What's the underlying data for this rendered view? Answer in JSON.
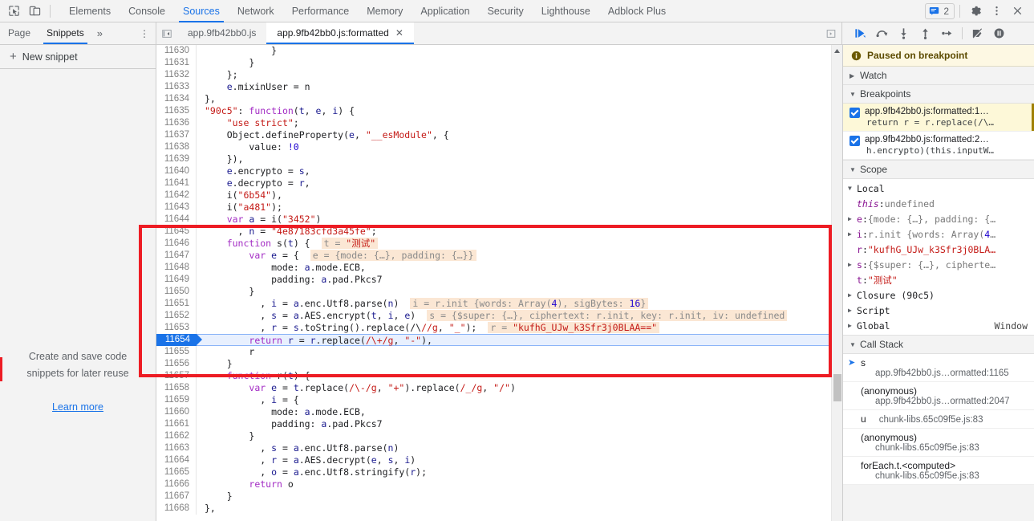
{
  "toolbar": {
    "icons": [
      {
        "name": "inspect-element-icon",
        "label": "Inspect element"
      },
      {
        "name": "device-toolbar-icon",
        "label": "Toggle device toolbar"
      }
    ],
    "panels": [
      {
        "label": "Elements",
        "active": false
      },
      {
        "label": "Console",
        "active": false
      },
      {
        "label": "Sources",
        "active": true
      },
      {
        "label": "Network",
        "active": false
      },
      {
        "label": "Performance",
        "active": false
      },
      {
        "label": "Memory",
        "active": false
      },
      {
        "label": "Application",
        "active": false
      },
      {
        "label": "Security",
        "active": false
      },
      {
        "label": "Lighthouse",
        "active": false
      },
      {
        "label": "Adblock Plus",
        "active": false
      }
    ],
    "message_count": "2",
    "settings_label": "Settings",
    "more_label": "More options",
    "close_label": "Close"
  },
  "navigator": {
    "tabs": [
      {
        "label": "Page",
        "active": false
      },
      {
        "label": "Snippets",
        "active": true
      }
    ],
    "more_tabs": "»",
    "kebab": "⋮",
    "new_snippet": "New snippet",
    "new_snippet_plus": "+",
    "empty_text": "Create and save code snippets for later reuse",
    "learn_more": "Learn more"
  },
  "editor": {
    "collapse_button": "|◀",
    "tabs": [
      {
        "label": "app.9fb42bb0.js",
        "active": false,
        "closable": false
      },
      {
        "label": "app.9fb42bb0.js:formatted",
        "active": true,
        "closable": true
      }
    ],
    "close_glyph": "✕",
    "popout_button": "▣",
    "execution_line": "11654",
    "lines": [
      {
        "n": "11630",
        "code": "            }"
      },
      {
        "n": "11631",
        "code": "        }"
      },
      {
        "n": "11632",
        "code": "    };"
      },
      {
        "n": "11633",
        "code": "    e.mixinUser = n"
      },
      {
        "n": "11634",
        "code": "},"
      },
      {
        "n": "11635",
        "code": "\"90c5\": function(t, e, i) {"
      },
      {
        "n": "11636",
        "code": "    \"use strict\";"
      },
      {
        "n": "11637",
        "code": "    Object.defineProperty(e, \"__esModule\", {"
      },
      {
        "n": "11638",
        "code": "        value: !0"
      },
      {
        "n": "11639",
        "code": "    }),"
      },
      {
        "n": "11640",
        "code": "    e.encrypto = s,"
      },
      {
        "n": "11641",
        "code": "    e.decrypto = r,"
      },
      {
        "n": "11642",
        "code": "    i(\"6b54\"),"
      },
      {
        "n": "11643",
        "code": "    i(\"a481\");"
      },
      {
        "n": "11644",
        "code": "    var a = i(\"3452\")"
      },
      {
        "n": "11645",
        "code": "      , n = \"4e87183cfd3a45fe\";"
      },
      {
        "n": "11646",
        "code": "    function s(t) {",
        "hint": "t = \"测试\""
      },
      {
        "n": "11647",
        "code": "        var e = {",
        "hint": "e = {mode: {…}, padding: {…}}"
      },
      {
        "n": "11648",
        "code": "            mode: a.mode.ECB,"
      },
      {
        "n": "11649",
        "code": "            padding: a.pad.Pkcs7"
      },
      {
        "n": "11650",
        "code": "        }"
      },
      {
        "n": "11651",
        "code": "          , i = a.enc.Utf8.parse(n)",
        "hint": "i = r.init {words: Array(4), sigBytes: 16}"
      },
      {
        "n": "11652",
        "code": "          , s = a.AES.encrypt(t, i, e)",
        "hint": "s = {$super: {…}, ciphertext: r.init, key: r.init, iv: undefined"
      },
      {
        "n": "11653",
        "code": "          , r = s.toString().replace(/\\//g, \"_\");",
        "hint": "r = \"kufhG_UJw_k3Sfr3j0BLAA==\""
      },
      {
        "n": "11654",
        "code": "        return r = r.replace(/\\+/g, \"-\"),",
        "exec": true
      },
      {
        "n": "11655",
        "code": "        r"
      },
      {
        "n": "11656",
        "code": "    }"
      },
      {
        "n": "11657",
        "code": "    function r(t) {"
      },
      {
        "n": "11658",
        "code": "        var e = t.replace(/\\-/g, \"+\").replace(/_/g, \"/\")"
      },
      {
        "n": "11659",
        "code": "          , i = {"
      },
      {
        "n": "11660",
        "code": "            mode: a.mode.ECB,"
      },
      {
        "n": "11661",
        "code": "            padding: a.pad.Pkcs7"
      },
      {
        "n": "11662",
        "code": "        }"
      },
      {
        "n": "11663",
        "code": "          , s = a.enc.Utf8.parse(n)"
      },
      {
        "n": "11664",
        "code": "          , r = a.AES.decrypt(e, s, i)"
      },
      {
        "n": "11665",
        "code": "          , o = a.enc.Utf8.stringify(r);"
      },
      {
        "n": "11666",
        "code": "        return o"
      },
      {
        "n": "11667",
        "code": "    }"
      },
      {
        "n": "11668",
        "code": "},"
      }
    ]
  },
  "debugger_toolbar": {
    "buttons": [
      {
        "name": "resume-script-button",
        "label": "Resume script execution"
      },
      {
        "name": "step-over-button",
        "label": "Step over next function call"
      },
      {
        "name": "step-into-button",
        "label": "Step into next function call"
      },
      {
        "name": "step-out-button",
        "label": "Step out of current function"
      },
      {
        "name": "step-button",
        "label": "Step"
      },
      {
        "name": "deactivate-breakpoints-button",
        "label": "Deactivate breakpoints"
      },
      {
        "name": "pause-on-exceptions-button",
        "label": "Pause on exceptions"
      }
    ]
  },
  "debugger": {
    "paused_banner": "Paused on breakpoint",
    "sections": {
      "watch": "Watch",
      "breakpoints": "Breakpoints",
      "scope": "Scope",
      "call_stack": "Call Stack"
    },
    "breakpoints": [
      {
        "checked": true,
        "location": "app.9fb42bb0.js:formatted:1…",
        "code": "return r = r.replace(/\\…",
        "selected": true
      },
      {
        "checked": true,
        "location": "app.9fb42bb0.js:formatted:2…",
        "code": "h.encrypto)(this.inputW…",
        "selected": false
      }
    ],
    "scope": {
      "groups": [
        {
          "name": "Local",
          "expanded": true
        },
        {
          "name": "Closure (90c5)",
          "expanded": false
        },
        {
          "name": "Script",
          "expanded": false
        },
        {
          "name": "Global",
          "expanded": false,
          "value": "Window"
        }
      ],
      "local_vars": [
        {
          "name": "this",
          "sep": ": ",
          "value": "undefined",
          "kind": "undef",
          "expandable": false,
          "italic": true
        },
        {
          "name": "e",
          "sep": ": ",
          "value": "{mode: {…}, padding: {…",
          "kind": "obj",
          "expandable": true
        },
        {
          "name": "i",
          "sep": ": ",
          "value": "r.init {words: Array(4…",
          "kind": "obj",
          "expandable": true
        },
        {
          "name": "r",
          "sep": ": ",
          "value": "\"kufhG_UJw_k3Sfr3j0BLA…",
          "kind": "str",
          "expandable": false
        },
        {
          "name": "s",
          "sep": ": ",
          "value": "{$super: {…}, cipherte…",
          "kind": "obj",
          "expandable": true
        },
        {
          "name": "t",
          "sep": ": ",
          "value": "\"测试\"",
          "kind": "str",
          "expandable": false
        }
      ]
    },
    "call_stack": [
      {
        "fn": "s",
        "loc": "app.9fb42bb0.js…ormatted:1165",
        "selected": true,
        "inline": false
      },
      {
        "fn": "(anonymous)",
        "loc": "app.9fb42bb0.js…ormatted:2047",
        "selected": false,
        "inline": false
      },
      {
        "fn": "u",
        "loc": "chunk-libs.65c09f5e.js:83",
        "selected": false,
        "inline": true
      },
      {
        "fn": "(anonymous)",
        "loc": "chunk-libs.65c09f5e.js:83",
        "selected": false,
        "inline": false
      },
      {
        "fn": "forEach.t.<computed>",
        "loc": "chunk-libs.65c09f5e.js:83",
        "selected": false,
        "inline": false
      }
    ]
  },
  "annotation": {
    "color": "#ed1c24",
    "shape": "rectangle"
  }
}
